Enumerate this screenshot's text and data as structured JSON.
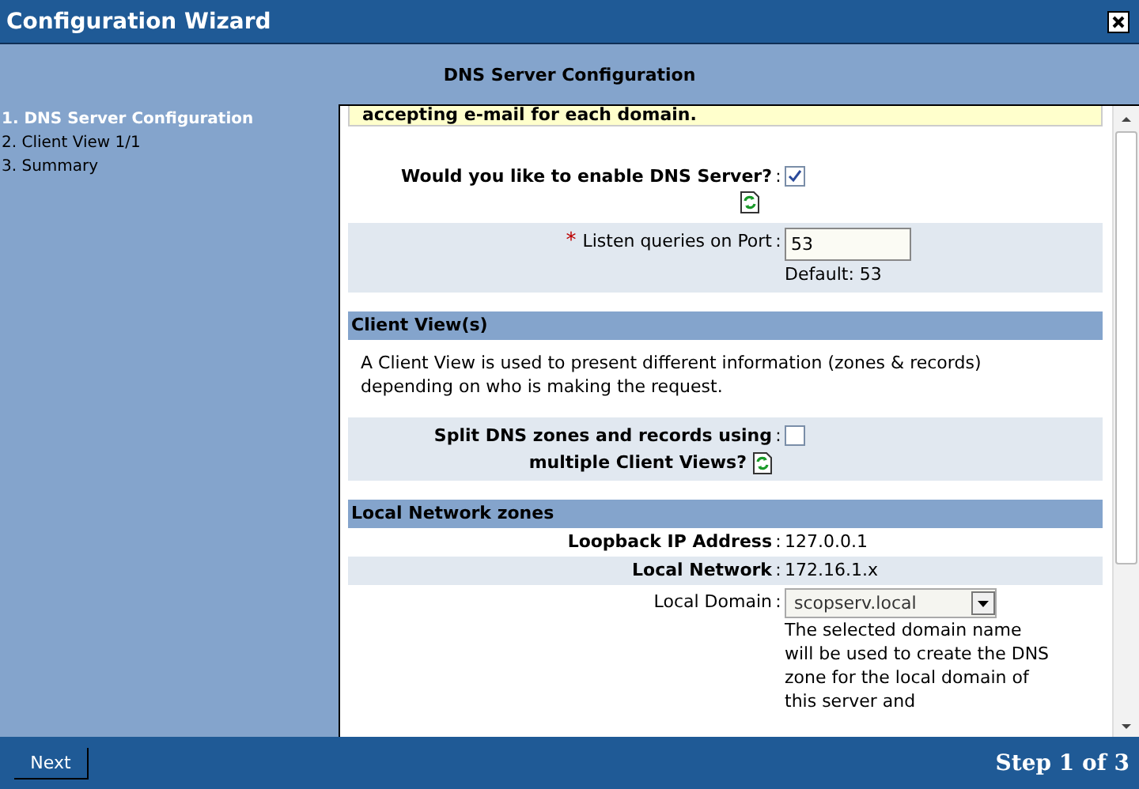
{
  "window": {
    "title": "Configuration Wizard"
  },
  "header": "DNS Server Configuration",
  "steps": [
    {
      "label": "1. DNS Server Configuration",
      "selected": true
    },
    {
      "label": "2. Client View 1/1",
      "selected": false
    },
    {
      "label": "3. Summary",
      "selected": false
    }
  ],
  "rows": [
    {
      "kind": "note",
      "text": "accepting e-mail for each domain."
    },
    {
      "kind": "checkbox",
      "lines": [
        "Would you like to enable DNS Server?"
      ],
      "colon": ":",
      "checked": true,
      "shaded": false
    },
    {
      "kind": "number",
      "label": "Listen queries on Port",
      "required_mark": "*",
      "colon": ":",
      "value": "53",
      "hint": "Default: 53",
      "shaded": true
    },
    {
      "kind": "heading",
      "text": "Client View(s)"
    },
    {
      "kind": "paragraph",
      "text": "A Client View is used to present different information (zones & records) depending on who is making the request."
    },
    {
      "kind": "checkbox",
      "lines": [
        "Split DNS zones and records using",
        "multiple Client Views?"
      ],
      "colon": ":",
      "checked": false,
      "shaded": true
    },
    {
      "kind": "heading",
      "text": "Local Network zones"
    },
    {
      "kind": "info",
      "label": "Loopback IP Address",
      "colon": ":",
      "value": "127.0.0.1",
      "shaded": false
    },
    {
      "kind": "info",
      "label": "Local Network",
      "colon": ":",
      "value": "172.16.1.x",
      "shaded": true
    },
    {
      "kind": "select",
      "label": "Local Domain",
      "colon": ":",
      "value": "scopserv.local",
      "hint": "The selected domain name will be used to create the DNS zone for the local domain of this server and",
      "shaded": false
    }
  ],
  "footer": {
    "button": "Next",
    "step": "Step 1 of 3"
  }
}
